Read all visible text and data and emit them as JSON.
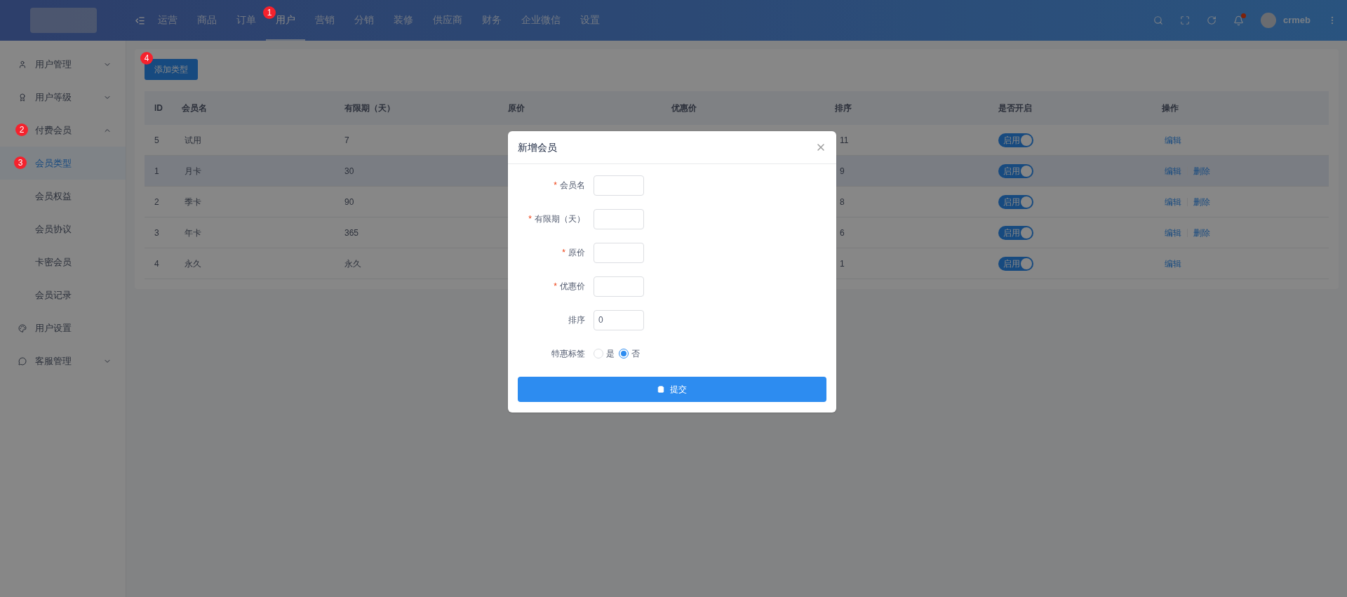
{
  "header": {
    "nav": [
      {
        "label": "运营",
        "selected": false
      },
      {
        "label": "商品",
        "selected": false
      },
      {
        "label": "订单",
        "selected": false
      },
      {
        "label": "用户",
        "selected": true,
        "step": "1"
      },
      {
        "label": "营销",
        "selected": false
      },
      {
        "label": "分销",
        "selected": false
      },
      {
        "label": "装修",
        "selected": false
      },
      {
        "label": "供应商",
        "selected": false
      },
      {
        "label": "财务",
        "selected": false
      },
      {
        "label": "企业微信",
        "selected": false
      },
      {
        "label": "设置",
        "selected": false
      }
    ],
    "notification_dot": true,
    "username": "crmeb"
  },
  "sidebar": {
    "items": [
      {
        "label": "用户管理",
        "expanded": false
      },
      {
        "label": "用户等级",
        "expanded": false
      },
      {
        "label": "付费会员",
        "expanded": true,
        "step": "2",
        "children": [
          {
            "label": "会员类型",
            "selected": true,
            "step": "3"
          },
          {
            "label": "会员权益",
            "selected": false
          },
          {
            "label": "会员协议",
            "selected": false
          },
          {
            "label": "卡密会员",
            "selected": false
          },
          {
            "label": "会员记录",
            "selected": false
          }
        ]
      },
      {
        "label": "用户设置"
      },
      {
        "label": "客服管理",
        "expanded": false
      }
    ]
  },
  "add_button": {
    "label": "添加类型",
    "step": "4"
  },
  "table": {
    "columns": [
      "ID",
      "会员名",
      "有限期（天）",
      "原价",
      "优惠价",
      "排序",
      "是否开启",
      "操作"
    ],
    "rows": [
      {
        "id": "5",
        "name": "试用",
        "days": "7",
        "sort": "11",
        "enabled": true,
        "switch_label": "启用",
        "actions": [
          "编辑"
        ],
        "hovered": false
      },
      {
        "id": "1",
        "name": "月卡",
        "days": "30",
        "sort": "9",
        "enabled": true,
        "switch_label": "启用",
        "actions": [
          "编辑",
          "删除"
        ],
        "hovered": true
      },
      {
        "id": "2",
        "name": "季卡",
        "days": "90",
        "sort": "8",
        "enabled": true,
        "switch_label": "启用",
        "actions": [
          "编辑",
          "删除"
        ],
        "hovered": false
      },
      {
        "id": "3",
        "name": "年卡",
        "days": "365",
        "sort": "6",
        "enabled": true,
        "switch_label": "启用",
        "actions": [
          "编辑",
          "删除"
        ],
        "hovered": false
      },
      {
        "id": "4",
        "name": "永久",
        "days": "永久",
        "sort": "1",
        "enabled": true,
        "switch_label": "启用",
        "actions": [
          "编辑"
        ],
        "hovered": false
      }
    ]
  },
  "modal": {
    "title": "新增会员",
    "fields": [
      {
        "kind": "input",
        "label": "会员名",
        "required": true
      },
      {
        "kind": "input",
        "label": "有限期（天）",
        "required": true
      },
      {
        "kind": "input",
        "label": "原价",
        "required": true
      },
      {
        "kind": "input",
        "label": "优惠价",
        "required": true
      },
      {
        "kind": "input",
        "label": "排序",
        "required": false,
        "value": "0"
      },
      {
        "kind": "radio",
        "label": "特惠标签",
        "required": false,
        "options": [
          {
            "label": "是",
            "selected": false
          },
          {
            "label": "否",
            "selected": true
          }
        ]
      }
    ],
    "submit": "提交",
    "required_mark": "*"
  }
}
